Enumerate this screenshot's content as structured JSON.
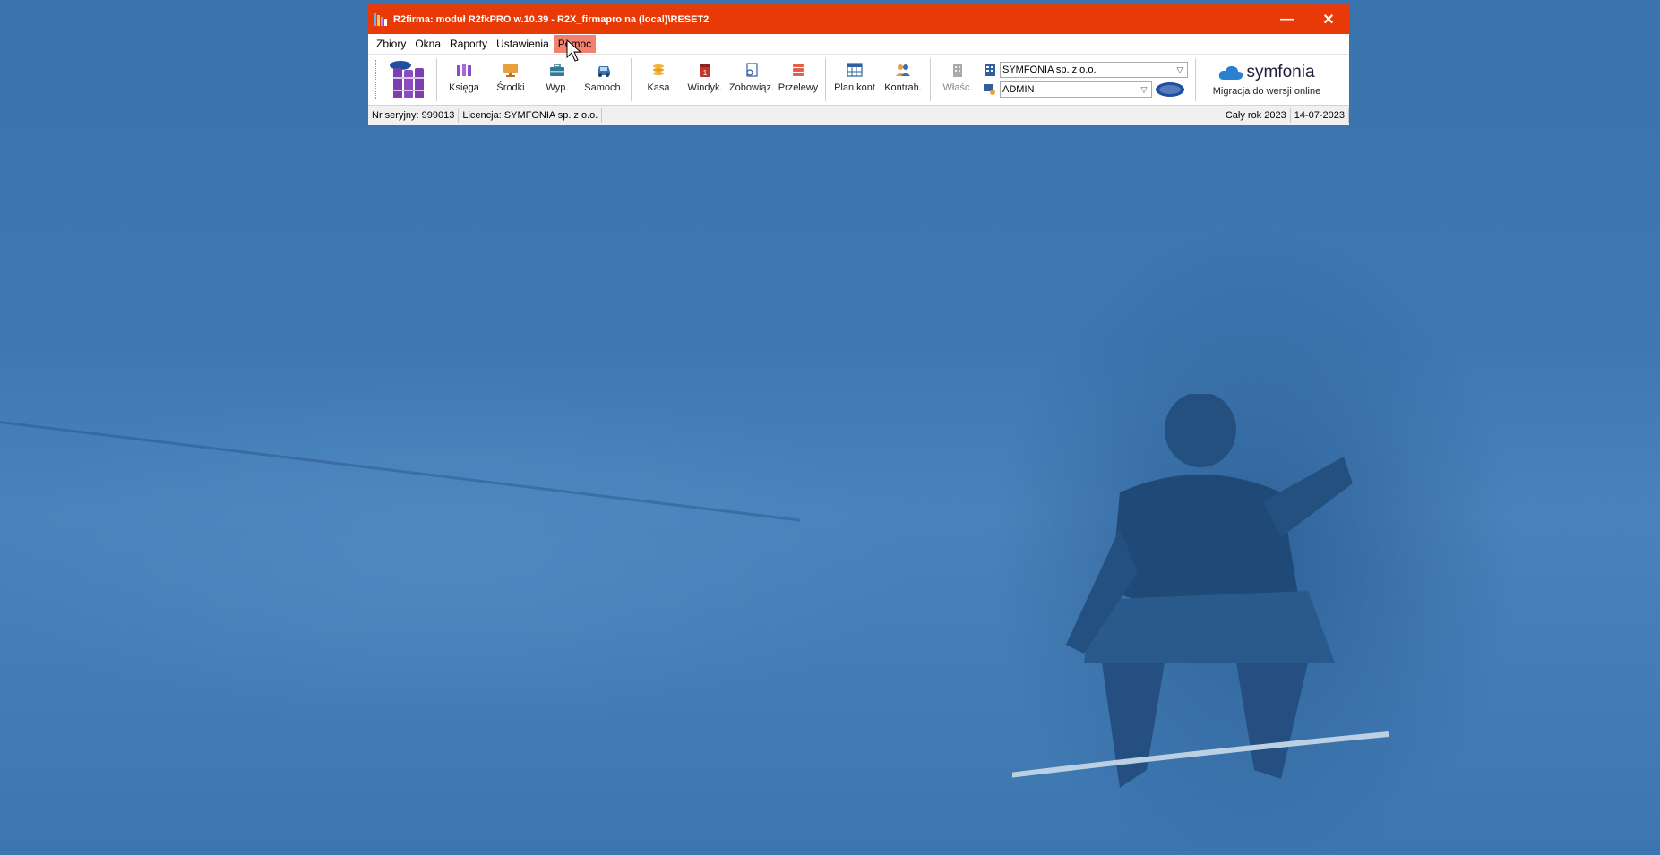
{
  "window": {
    "title": "R2firma: moduł R2fkPRO w.10.39 - R2X_firmapro na (local)\\RESET2",
    "minimize_glyph": "—",
    "close_glyph": "✕"
  },
  "menu": [
    {
      "label": "Zbiory"
    },
    {
      "label": "Okna"
    },
    {
      "label": "Raporty"
    },
    {
      "label": "Ustawienia"
    },
    {
      "label": "Pomoc",
      "active": true
    }
  ],
  "toolbar": {
    "ksiega": "Księga",
    "srodki": "Środki",
    "wyp": "Wyp.",
    "samoch": "Samoch.",
    "kasa": "Kasa",
    "windyk": "Windyk.",
    "zobowiaz": "Zobowiąz.",
    "przelewy": "Przelewy",
    "plan_kont": "Plan kont",
    "kontrah": "Kontrah.",
    "wlasc": "Właśc."
  },
  "selectors": {
    "company": "SYMFONIA sp. z o.o.",
    "user": "ADMIN"
  },
  "promo": {
    "brand": "symfonia",
    "text": "Migracja do wersji online"
  },
  "status": {
    "serial": "Nr seryjny: 999013",
    "license": "Licencja: SYMFONIA sp. z o.o.",
    "period": "Cały rok 2023",
    "date": "14-07-2023"
  },
  "colors": {
    "titlebar": "#e83a06",
    "menu_active": "#f2826f",
    "desktop": "#3e78b1"
  }
}
